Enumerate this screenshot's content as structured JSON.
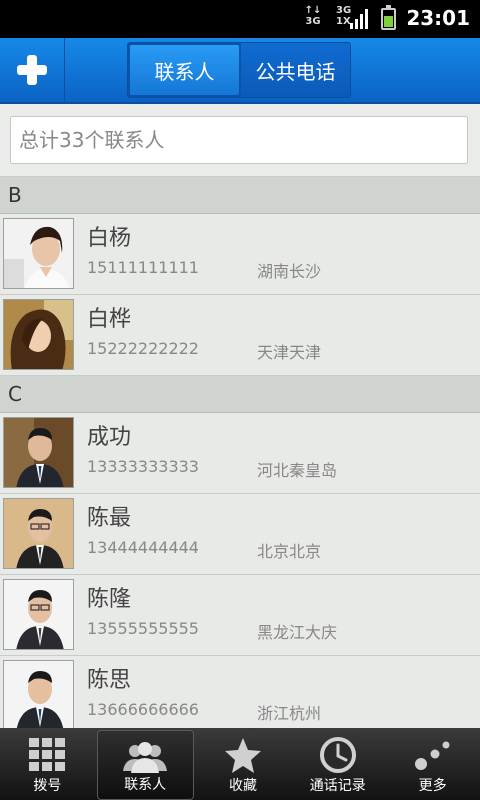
{
  "status_bar": {
    "net1_top": "↑↓",
    "net1_bottom": "3G",
    "net2_top": "3G",
    "net2_bottom": "1X",
    "time": "23:01"
  },
  "header": {
    "add_icon": "plus-icon",
    "tabs": [
      {
        "label": "联系人",
        "active": true
      },
      {
        "label": "公共电话",
        "active": false
      }
    ]
  },
  "search": {
    "placeholder": "总计33个联系人"
  },
  "sections": [
    {
      "letter": "B",
      "contacts": [
        {
          "name": "白杨",
          "phone": "15111111111",
          "city": "湖南长沙"
        },
        {
          "name": "白桦",
          "phone": "15222222222",
          "city": "天津天津"
        }
      ]
    },
    {
      "letter": "C",
      "contacts": [
        {
          "name": "成功",
          "phone": "13333333333",
          "city": "河北秦皇岛"
        },
        {
          "name": "陈最",
          "phone": "13444444444",
          "city": "北京北京"
        },
        {
          "name": "陈隆",
          "phone": "13555555555",
          "city": "黑龙江大庆"
        },
        {
          "name": "陈思",
          "phone": "13666666666",
          "city": "浙江杭州"
        }
      ]
    }
  ],
  "tabbar": [
    {
      "label": "拨号",
      "icon": "dialpad-icon"
    },
    {
      "label": "联系人",
      "icon": "contacts-icon",
      "active": true
    },
    {
      "label": "收藏",
      "icon": "star-icon"
    },
    {
      "label": "通话记录",
      "icon": "clock-icon"
    },
    {
      "label": "更多",
      "icon": "more-dots-icon"
    }
  ]
}
